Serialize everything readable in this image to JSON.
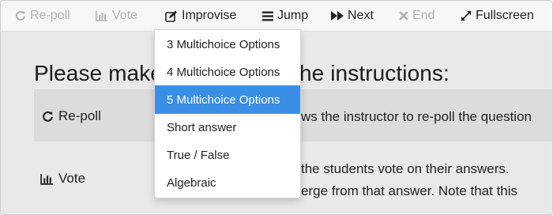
{
  "toolbar": {
    "repoll_label": "Re-poll",
    "vote_label": "Vote",
    "improvise_label": "Improvise",
    "jump_label": "Jump",
    "next_label": "Next",
    "end_label": "End",
    "fullscreen_label": "Fullscreen"
  },
  "improvise_menu": {
    "items": [
      {
        "label": "3 Multichoice Options"
      },
      {
        "label": "4 Multichoice Options"
      },
      {
        "label": "5 Multichoice Options",
        "active": true
      },
      {
        "label": "Short answer"
      },
      {
        "label": "True / False"
      },
      {
        "label": "Algebraic"
      }
    ]
  },
  "content": {
    "heading_left": "Please make",
    "heading_right": "he instructions:",
    "rows": [
      {
        "icon": "refresh-icon",
        "label": "Re-poll",
        "description": "ws the instructor to re-poll the question"
      },
      {
        "icon": "bar-chart-icon",
        "label": "Vote",
        "description_line1": "the students vote on their answers.",
        "description_line2": "erge from that answer. Note that this"
      }
    ]
  },
  "colors": {
    "toolbar_bg": "#f7f7f7",
    "content_bg": "#e8e8e8",
    "row_highlight": "#dcdcdc",
    "menu_active": "#3a8ee6",
    "disabled_text": "#b0b0b0"
  }
}
